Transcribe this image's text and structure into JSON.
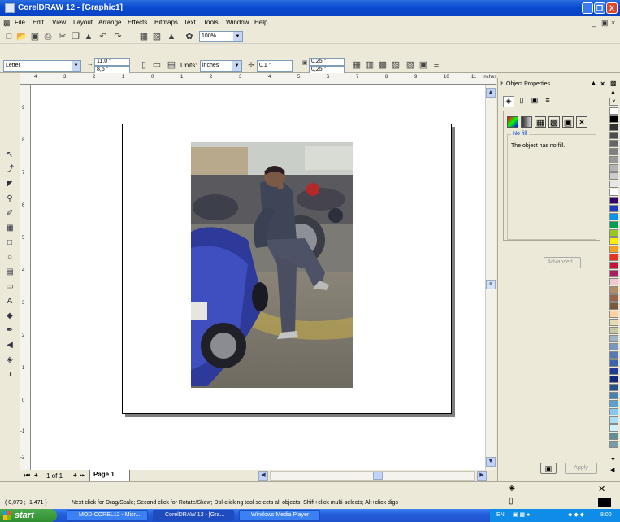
{
  "window": {
    "title": "CorelDRAW 12 - [Graphic1]",
    "controls": [
      "_",
      "❐",
      "X"
    ]
  },
  "menu": [
    "File",
    "Edit",
    "View",
    "Layout",
    "Arrange",
    "Effects",
    "Bitmaps",
    "Text",
    "Tools",
    "Window",
    "Help"
  ],
  "toolbar": {
    "zoom": "100%"
  },
  "property_bar": {
    "paper": "Letter",
    "width": "11,0 \"",
    "height": "8,5 \"",
    "units_label": "Units:",
    "units": "inches",
    "nudge": "0,1 \"",
    "dup_x": "0,25 \"",
    "dup_y": "0,25 \""
  },
  "ruler": {
    "unit": "inches",
    "h_ticks": [
      "4",
      "3",
      "2",
      "1",
      "0",
      "1",
      "2",
      "3",
      "4",
      "5",
      "6",
      "7",
      "8",
      "9",
      "10",
      "11"
    ],
    "v_ticks": [
      "9",
      "8",
      "7",
      "6",
      "5",
      "4",
      "3",
      "2",
      "1",
      "0",
      "-1",
      "-2"
    ]
  },
  "page_nav": {
    "count": "1 of 1",
    "tab": "Page 1"
  },
  "docker": {
    "title": "Object Properties",
    "fill_section": "No fill",
    "fill_message": "The object has no fill.",
    "advanced": "Advanced...",
    "apply": "Apply"
  },
  "palette_colors": [
    "#ffffff",
    "#000000",
    "#333333",
    "#4d4d4d",
    "#666666",
    "#808080",
    "#999999",
    "#b3b3b3",
    "#cccccc",
    "#e6e6e6",
    "#ffffff",
    "#330066",
    "#1e3cbe",
    "#0096e6",
    "#00a050",
    "#96c81e",
    "#fff000",
    "#f0a01e",
    "#e6321e",
    "#c8143c",
    "#aa1e64",
    "#f0c8d2",
    "#b48c64",
    "#966446",
    "#785a3c",
    "#ffd2a0",
    "#e6dcb4",
    "#c8c8a0",
    "#a0b4c8",
    "#7896be",
    "#5a78b4",
    "#3c64aa",
    "#1e3c96",
    "#14287d",
    "#28508c",
    "#4682b4",
    "#5aa0d2",
    "#82c8f0",
    "#aadcf5",
    "#d2f0fa",
    "#648c96",
    "#789ba5"
  ],
  "status": {
    "coords": "( 0,079 ; -1,471 )",
    "hint": "Next click for Drag/Scale; Second click for Rotate/Skew; Dbl-clicking tool selects all objects; Shift+click multi-selects; Alt+click digs"
  },
  "taskbar": {
    "start": "start",
    "tasks": [
      "MOD-COREL12 - Micr...",
      "CorelDRAW 12 - [Gra...",
      "Windows Media Player"
    ],
    "lang": "EN",
    "clock": "8:00"
  }
}
